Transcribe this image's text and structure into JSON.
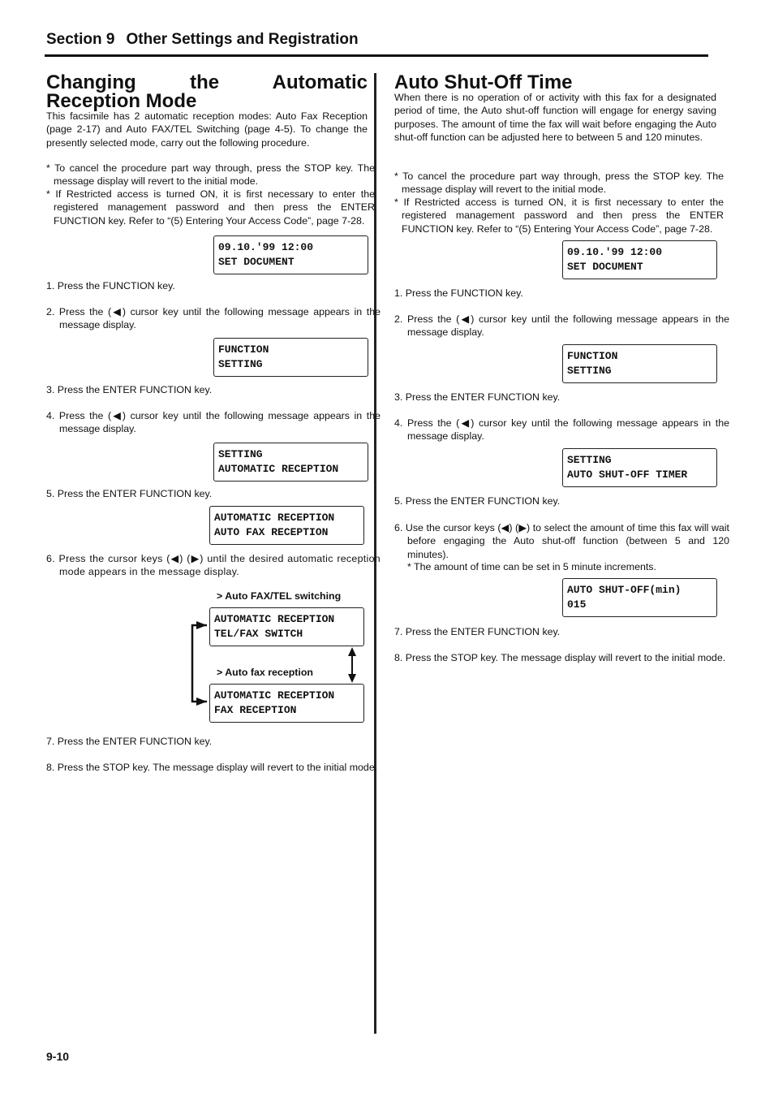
{
  "header": {
    "section_number": "Section 9",
    "section_title": "Other Settings and Registration"
  },
  "left": {
    "title": "Changing the Automatic Reception Mode",
    "intro": "This facsimile has 2 automatic reception modes: Auto Fax Reception (page 2-17) and Auto FAX/TEL Switching (page 4-5). To change the presently selected mode, carry out the following procedure.",
    "notes": [
      "* To cancel the procedure part way through, press the STOP key. The message display will revert to the initial mode.",
      "* If Restricted access is turned ON, it is first necessary to enter the registered management password and then press the ENTER FUNCTION key. Refer to “(5) Entering Your Access Code”, page 7-28."
    ],
    "displays": {
      "initial": [
        "09.10.'99 12:00",
        "SET DOCUMENT"
      ],
      "function": [
        "FUNCTION",
        "SETTING"
      ],
      "setting": [
        "SETTING",
        "AUTOMATIC RECEPTION"
      ],
      "current": [
        "AUTOMATIC RECEPTION",
        "AUTO FAX RECEPTION"
      ],
      "telfax": [
        "AUTOMATIC RECEPTION",
        "TEL/FAX SWITCH"
      ],
      "fax": [
        "AUTOMATIC RECEPTION",
        "FAX RECEPTION"
      ]
    },
    "labels": {
      "telfax": "> Auto FAX/TEL switching",
      "fax": "> Auto fax reception"
    },
    "steps": [
      "1. Press the FUNCTION key.",
      "2. Press the (◀) cursor key until the following message appears in the message display.",
      "3. Press the ENTER FUNCTION key.",
      "4. Press the (◀) cursor key until the following message appears in the message display.",
      "5. Press the ENTER FUNCTION key.",
      "6. Press the cursor keys (◀) (▶) until the desired automatic reception mode appears in the message display.",
      "7. Press the ENTER FUNCTION key.",
      "8. Press the STOP key. The message display will revert to the initial mode."
    ]
  },
  "right": {
    "title": "Auto Shut-Off Time",
    "intro": "When there is no operation of or activity with this fax for a designated period of time, the Auto shut-off function will engage for energy saving purposes. The amount of time the fax will wait before engaging the Auto shut-off function can be adjusted here to between 5 and 120 minutes.",
    "notes": [
      "* To cancel the procedure part way through, press the STOP key. The message display will revert to the initial mode.",
      "* If Restricted access is turned ON, it is first necessary to enter the registered management password and then press the ENTER FUNCTION key. Refer to “(5) Entering Your Access Code”, page 7-28."
    ],
    "displays": {
      "initial": [
        "09.10.'99 12:00",
        "SET DOCUMENT"
      ],
      "function": [
        "FUNCTION",
        "SETTING"
      ],
      "setting": [
        "SETTING",
        "AUTO SHUT-OFF TIMER"
      ],
      "minutes": [
        "AUTO SHUT-OFF(min)",
        "015"
      ]
    },
    "steps": [
      "1. Press the FUNCTION key.",
      "2. Press the (◀) cursor key until the following message appears in the message display.",
      "3. Press the ENTER FUNCTION key.",
      "4. Press the (◀) cursor key until the following message appears in the message display.",
      "5. Press the ENTER FUNCTION key.",
      "6. Use the cursor keys (◀) (▶) to select the amount of time this fax will wait before engaging the Auto shut-off function (between 5 and 120 minutes).",
      "7. Press the ENTER FUNCTION key.",
      "8. Press the STOP key. The message display will revert to the initial mode."
    ],
    "step6_note": "* The amount of time can be set in 5 minute increments."
  },
  "footer": {
    "page_number": "9-10"
  }
}
